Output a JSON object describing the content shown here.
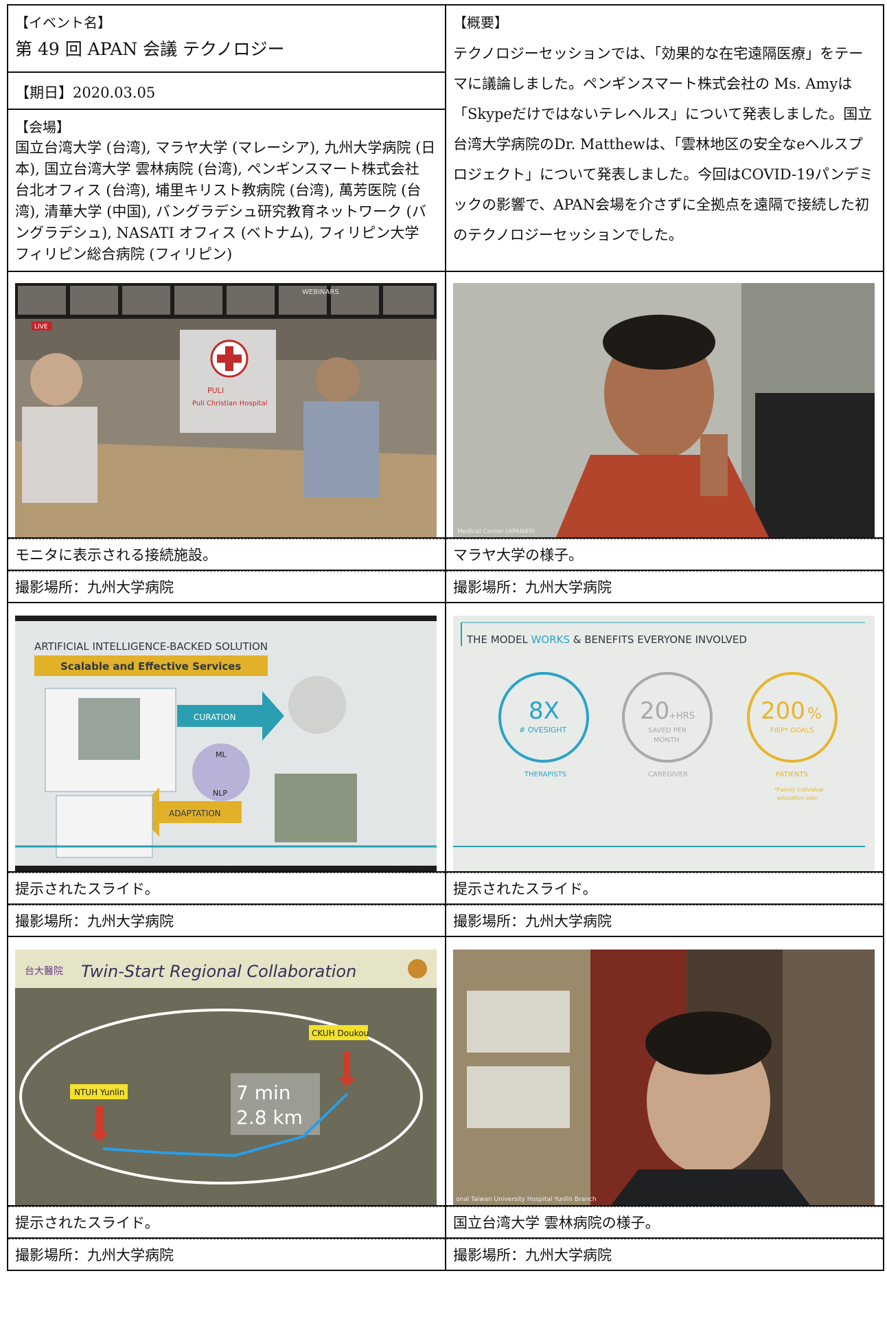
{
  "event": {
    "label": "【イベント名】",
    "title": "第 49 回 APAN 会議 テクノロジー",
    "date": "【期日】2020.03.05",
    "venue_label": "【会場】",
    "venue": "国立台湾大学 (台湾), マラヤ大学 (マレーシア), 九州大学病院 (日本), 国立台湾大学 雲林病院 (台湾), ペンギンスマート株式会社 台北オフィス (台湾), 埔里キリスト教病院 (台湾), 萬芳医院 (台湾), 清華大学 (中国), バングラデシュ研究教育ネットワーク (バングラデシュ), NASATI オフィス (ベトナム), フィリピン大学 フィリピン総合病院 (フィリピン)"
  },
  "summary": {
    "label": "【概要】",
    "text": "テクノロジーセッションでは、「効果的な在宅遠隔医療」をテーマに議論しました。ペンギンスマート株式会社の Ms. Amyは「Skypeだけではないテレヘルス」について発表しました。国立台湾大学病院のDr. Matthewは、「雲林地区の安全なeヘルスプロジェクト」について発表しました。今回はCOVID-19パンデミックの影響で、APAN会場を介さずに全拠点を遠隔で接続した初のテクノロジーセッションでした。"
  },
  "photos": [
    {
      "caption": "モニタに表示される接続施設。",
      "place": "撮影場所：九州大学病院",
      "overlay": {
        "live": "LIVE",
        "webinars": "WEBINARS",
        "banner_brand": "PULI",
        "banner_line": "Puli Christian Hospital"
      }
    },
    {
      "caption": "マラヤ大学の様子。",
      "place": "撮影場所：九州大学病院",
      "overlay": {
        "corner": "Medical Center (APAN49)"
      }
    },
    {
      "caption": "提示されたスライド。",
      "place": "撮影場所：九州大学病院",
      "slide": {
        "title": "ARTIFICIAL INTELLIGENCE-BACKED SOLUTION",
        "subtitle": "Scalable and Effective Services",
        "curation": "CURATION",
        "adaptation": "ADAPTATION",
        "ml": "ML",
        "nlp": "NLP"
      }
    },
    {
      "caption": "提示されたスライド。",
      "place": "撮影場所：九州大学病院",
      "slide": {
        "title_a": "THE MODEL ",
        "title_b": "WORKS",
        "title_c": " & BENEFITS EVERYONE INVOLVED",
        "c1_big": "8X",
        "c1_small": "# OVESIGHT",
        "c1_label": "THERAPISTS",
        "c2_big": "20",
        "c2_plus": "+HRS",
        "c2_small1": "SAVED PER",
        "c2_small2": "MONTH",
        "c2_label": "CAREGIVER",
        "c3_big": "200",
        "c3_pct": "%",
        "c3_small": "FIEP* GOALS",
        "c3_label": "PATIENTS",
        "note1": "*Family individual",
        "note2": "education plan"
      }
    },
    {
      "caption": "提示されたスライド。",
      "place": "撮影場所：九州大学病院",
      "slide": {
        "title": "Twin-Start Regional Collaboration",
        "logo": "台大醫院",
        "label1": "CKUH Doukou",
        "label2": "NTUH Yunlin",
        "time": "7 min",
        "dist": "2.8 km"
      }
    },
    {
      "caption": "国立台湾大学 雲林病院の様子。",
      "place": "撮影場所：九州大学病院",
      "overlay": {
        "corner": "onal Taiwan University Hospital Yunlin Branch"
      }
    }
  ]
}
